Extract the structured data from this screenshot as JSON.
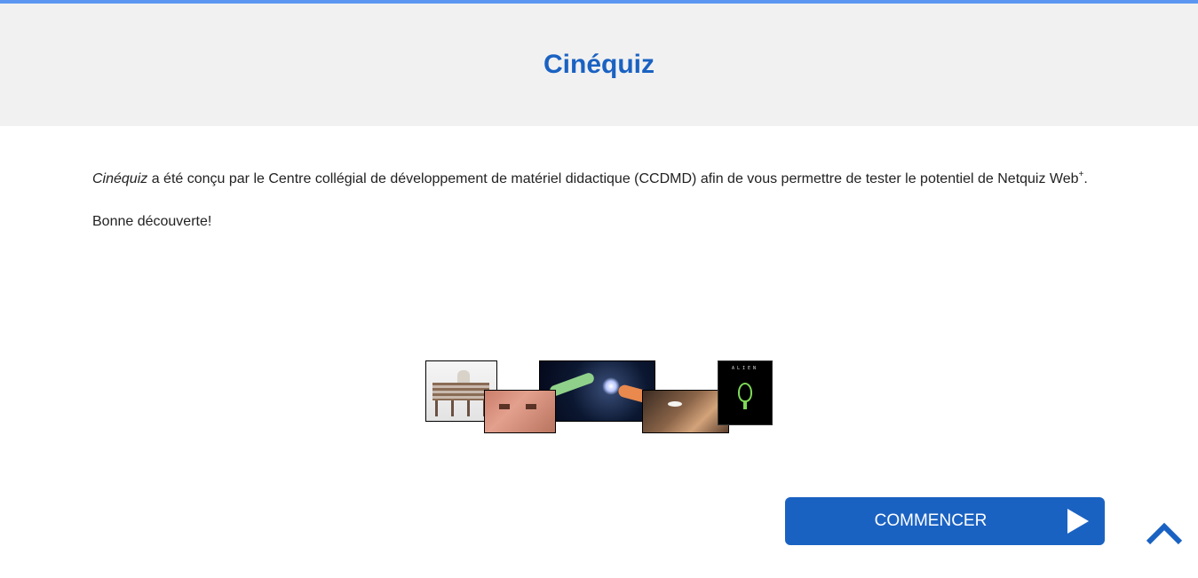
{
  "header": {
    "title": "Cinéquiz"
  },
  "intro": {
    "title_italic": "Cinéquiz",
    "text_main": " a été conçu par le Centre collégial de développement de matériel didactique (CCDMD) afin de vous permettre de tester le potentiel de Netquiz Web",
    "superscript": "+",
    "text_end": ".",
    "greeting": "Bonne découverte!"
  },
  "collage": {
    "alien_title": "ALIEN"
  },
  "actions": {
    "start_label": "COMMENCER",
    "start_icon": "play-icon",
    "scroll_top_icon": "chevron-up-icon"
  },
  "colors": {
    "accent": "#1a62c2",
    "top_bar": "#5b97f0",
    "header_bg": "#f1f1f1"
  }
}
